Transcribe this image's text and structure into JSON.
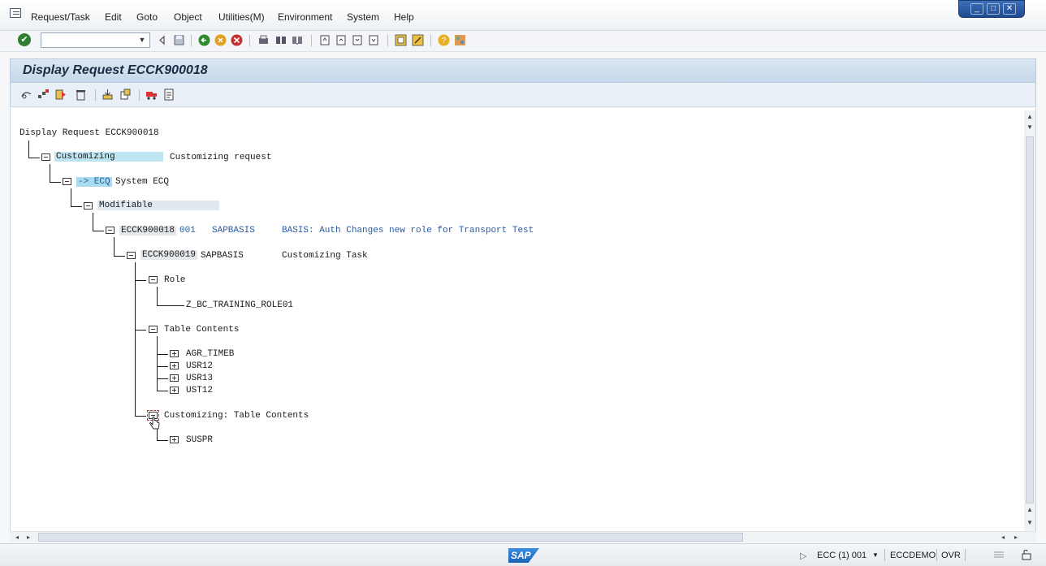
{
  "menu": [
    "Request/Task",
    "Edit",
    "Goto",
    "Object",
    "Utilities(M)",
    "Environment",
    "System",
    "Help"
  ],
  "window_controls": {
    "minimize": "_",
    "restore": "□",
    "close": "✕"
  },
  "toolbar": {
    "command_value": "",
    "dropdown_glyph": "▼",
    "ok_glyph": "✔"
  },
  "title": "Display Request ECCK900018",
  "tree": {
    "root": "Display Request ECCK900018",
    "customizing": {
      "label": "Customizing",
      "desc": "Customizing request"
    },
    "target": {
      "label": "-> ECQ",
      "desc": "System ECQ"
    },
    "modifiable": "Modifiable",
    "request": {
      "id": "ECCK900018",
      "client": "001",
      "owner": "SAPBASIS",
      "desc": "BASIS: Auth Changes new role for Transport Test"
    },
    "task": {
      "id": "ECCK900019",
      "owner": "SAPBASIS",
      "desc": "Customizing Task"
    },
    "role": "Role",
    "role_item": "Z_BC_TRAINING_ROLE01",
    "table_contents": "Table Contents",
    "tables": [
      "AGR_TIMEB",
      "USR12",
      "USR13",
      "UST12"
    ],
    "cust_table_contents": "Customizing: Table Contents",
    "cust_tables": [
      "SUSPR"
    ]
  },
  "status": {
    "logo": "SAP",
    "system": "ECC (1) 001",
    "server": "ECCDEMO",
    "mode": "OVR",
    "expand_glyph": "▷",
    "dropdown_glyph": "▼"
  }
}
